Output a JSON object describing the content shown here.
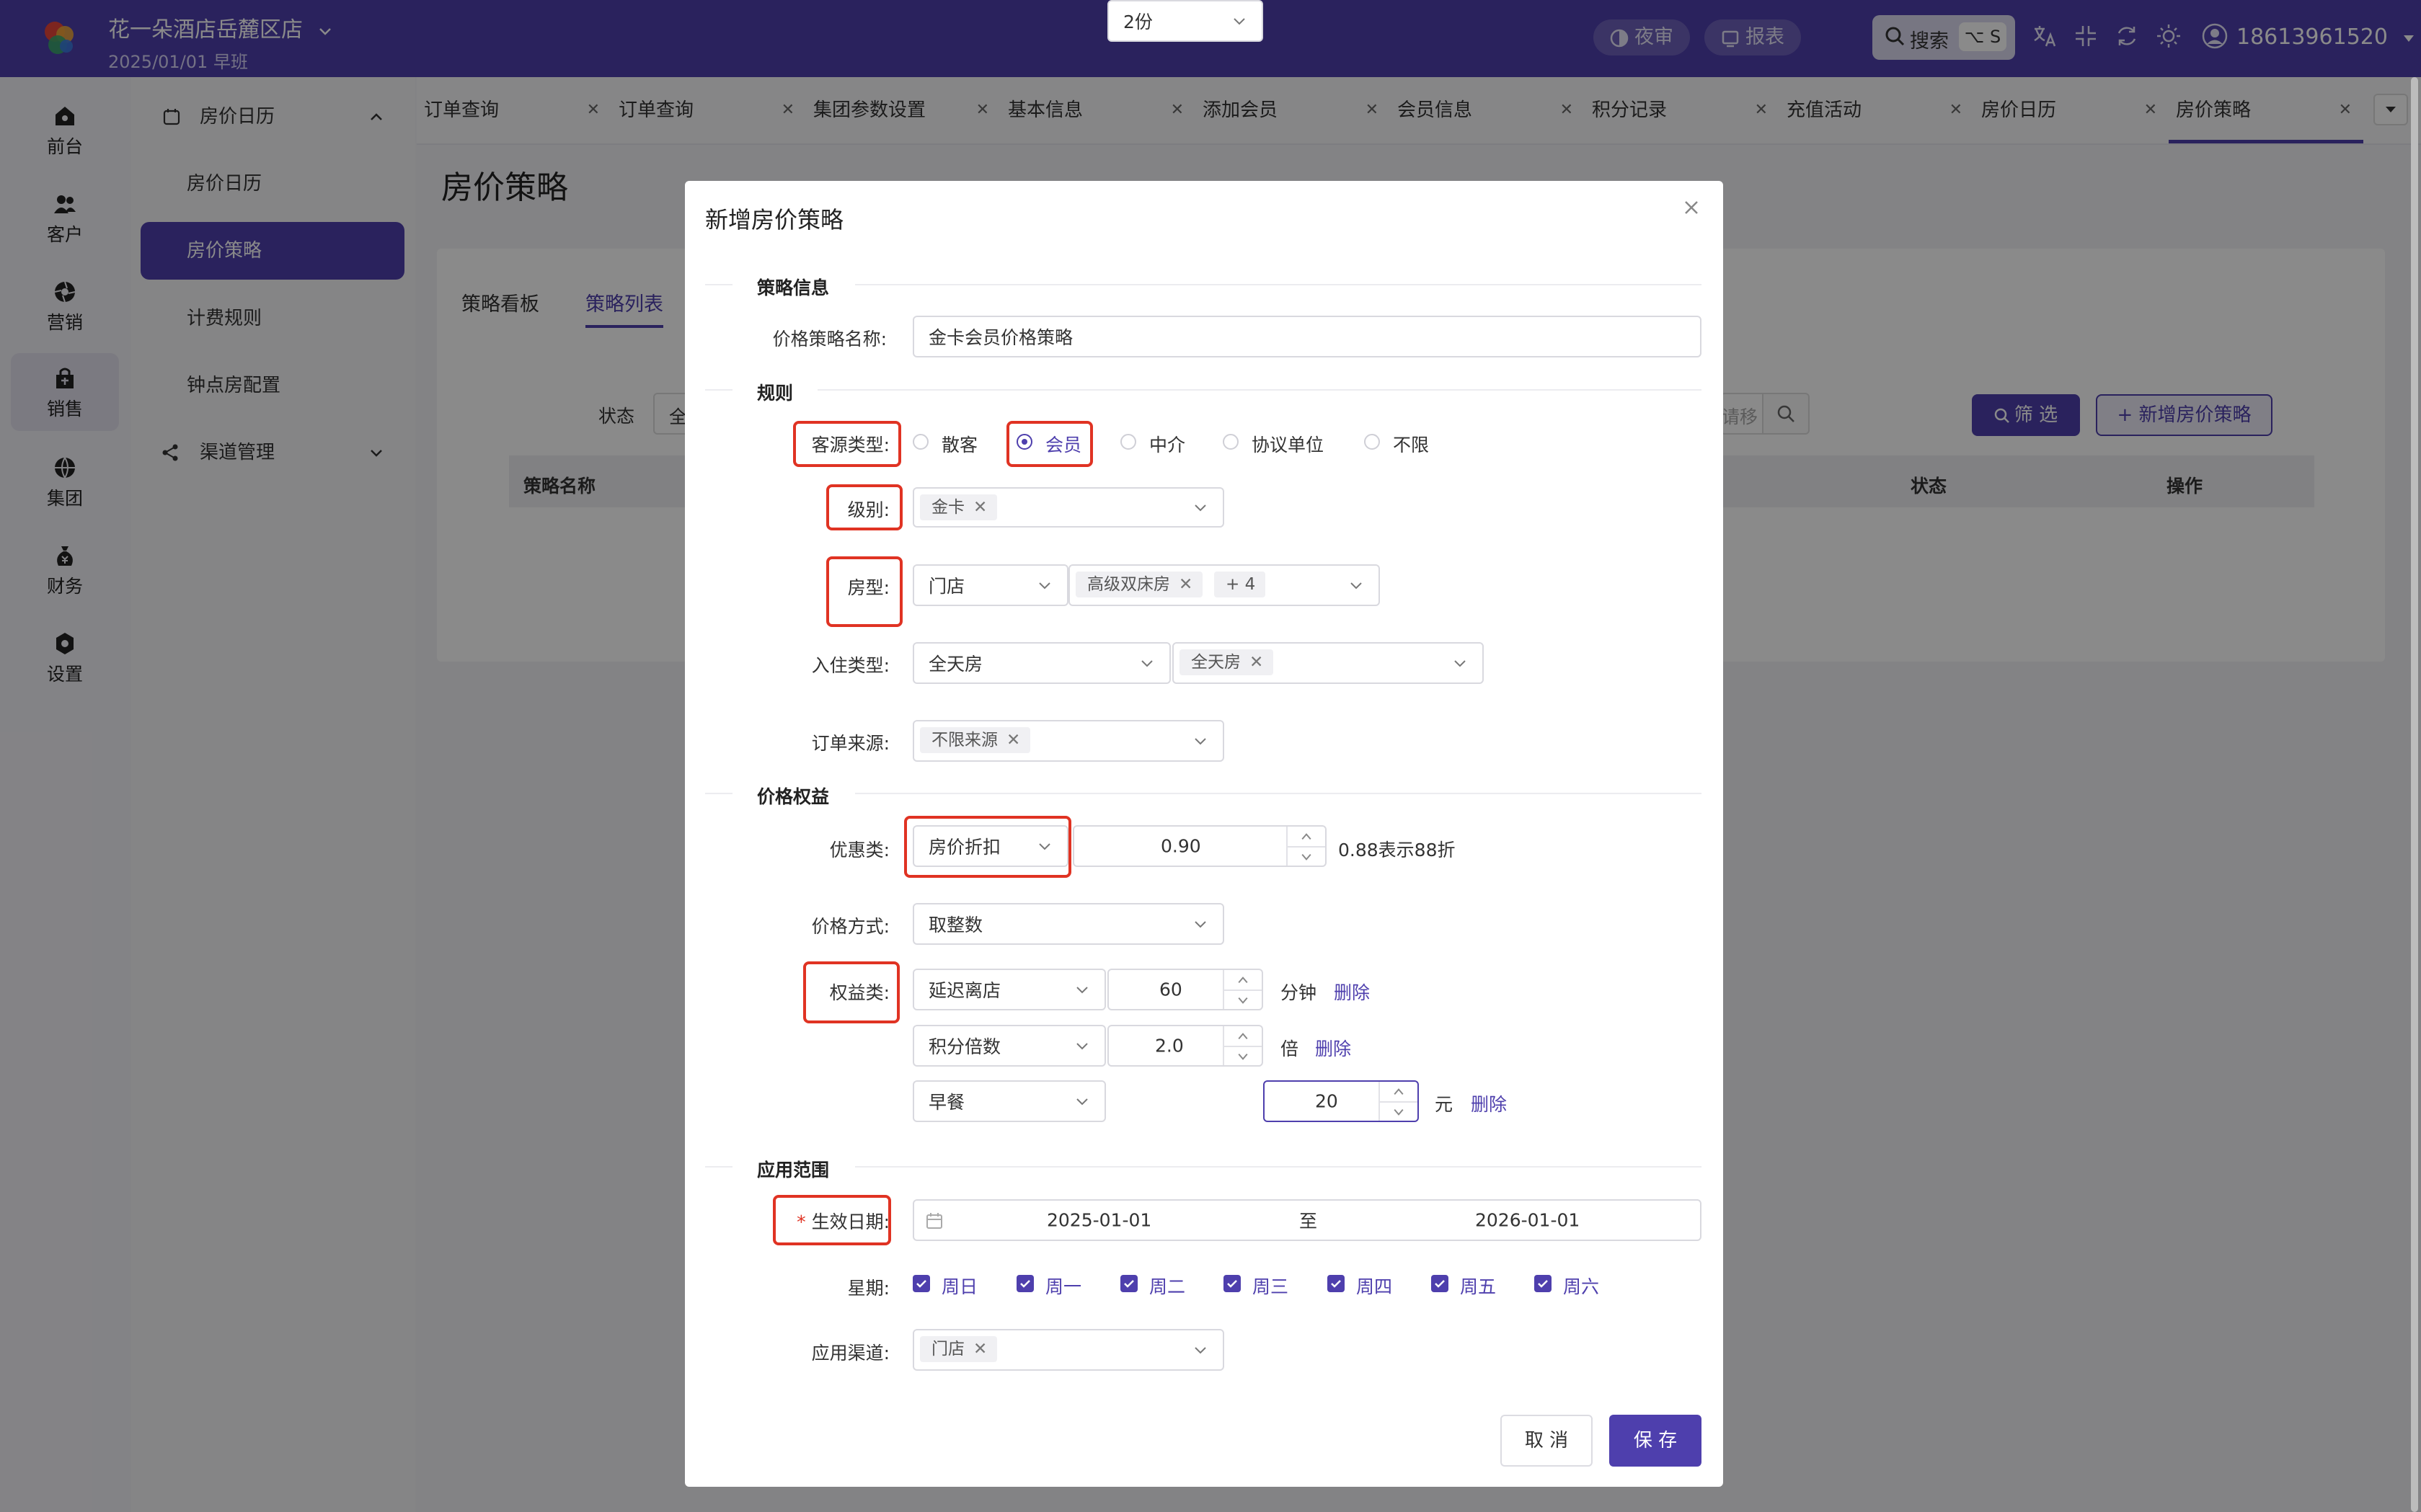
{
  "header": {
    "hotel_name": "花一朵酒店岳麓区店",
    "date_shift": "2025/01/01   早班",
    "night_audit": "夜审",
    "report": "报表",
    "search_label": "搜索",
    "search_shortcut": "⌥ S",
    "user_phone": "18613961520",
    "brand_color": "#4e3fad"
  },
  "rail": {
    "items": [
      {
        "label": "前台",
        "icon": "home-icon"
      },
      {
        "label": "客户",
        "icon": "users-icon"
      },
      {
        "label": "营销",
        "icon": "aperture-icon"
      },
      {
        "label": "销售",
        "icon": "bag-icon"
      },
      {
        "label": "集团",
        "icon": "globe-icon"
      },
      {
        "label": "财务",
        "icon": "money-bag-icon"
      },
      {
        "label": "设置",
        "icon": "gear-icon"
      }
    ],
    "active": "销售"
  },
  "submenu": {
    "group1": "房价日历",
    "items": [
      "房价日历",
      "房价策略",
      "计费规则",
      "钟点房配置"
    ],
    "active": "房价策略",
    "group2": "渠道管理"
  },
  "tabs": [
    {
      "label": "订单查询"
    },
    {
      "label": "订单查询"
    },
    {
      "label": "集团参数设置"
    },
    {
      "label": "基本信息"
    },
    {
      "label": "添加会员"
    },
    {
      "label": "会员信息"
    },
    {
      "label": "积分记录"
    },
    {
      "label": "充值活动"
    },
    {
      "label": "房价日历"
    },
    {
      "label": "房价策略"
    }
  ],
  "page": {
    "title": "房价策略",
    "inner_tabs": [
      "策略看板",
      "策略列表"
    ],
    "status_label": "状态",
    "status_value_partial": "全",
    "search_placeholder_partial": "请移",
    "filter_button": "筛 选",
    "add_button": "+ 新增房价策略",
    "table_headers": [
      "策略名称",
      "状态",
      "操作"
    ]
  },
  "modal": {
    "title": "新增房价策略",
    "sections": {
      "info": "策略信息",
      "rules": "规则",
      "benefits": "价格权益",
      "scope": "应用范围"
    },
    "fields": {
      "name_label": "价格策略名称:",
      "name_value": "金卡会员价格策略",
      "source_label": "客源类型:",
      "source_options": [
        "散客",
        "会员",
        "中介",
        "协议单位",
        "不限"
      ],
      "source_selected": "会员",
      "level_label": "级别:",
      "level_tag": "金卡",
      "room_label": "房型:",
      "room_scope": "门店",
      "room_tag": "高级双床房",
      "room_more": "+ 4",
      "checkin_label": "入住类型:",
      "checkin_type": "全天房",
      "checkin_tag": "全天房",
      "order_source_label": "订单来源:",
      "order_source_tag": "不限来源",
      "discount_label": "优惠类:",
      "discount_type": "房价折扣",
      "discount_value": "0.90",
      "discount_hint": "0.88表示88折",
      "price_mode_label": "价格方式:",
      "price_mode": "取整数",
      "benefit_label": "权益类:",
      "benefits": [
        {
          "type": "延迟离店",
          "value": "60",
          "unit": "分钟",
          "action": "删除"
        },
        {
          "type": "积分倍数",
          "value": "2.0",
          "unit": "倍",
          "action": "删除"
        },
        {
          "type": "早餐",
          "portion": "2份",
          "value": "20",
          "unit": "元",
          "action": "删除"
        }
      ],
      "date_label": "生效日期:",
      "date_required": "*",
      "date_start": "2025-01-01",
      "date_sep": "至",
      "date_end": "2026-01-01",
      "week_label": "星期:",
      "weekdays": [
        "周日",
        "周一",
        "周二",
        "周三",
        "周四",
        "周五",
        "周六"
      ],
      "channel_label": "应用渠道:",
      "channel_tag": "门店"
    },
    "cancel": "取 消",
    "save": "保 存"
  },
  "annotation_color": "#e03323"
}
